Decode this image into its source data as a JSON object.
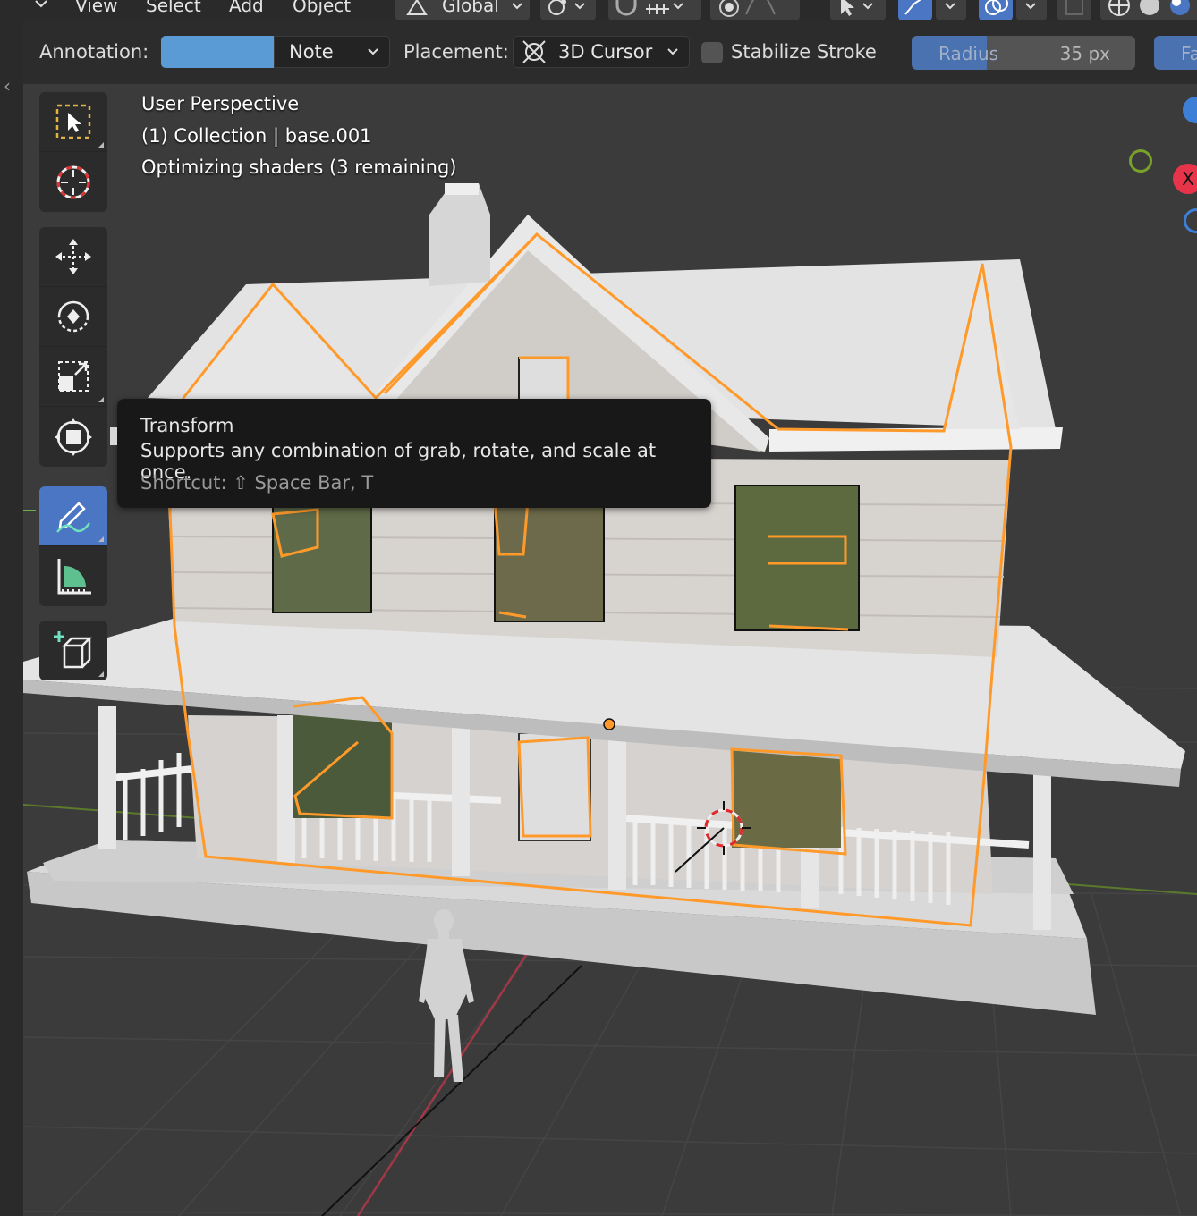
{
  "header": {
    "menu": [
      "View",
      "Select",
      "Add",
      "Object"
    ],
    "orientation_label": "Global"
  },
  "tool_settings": {
    "annotation_label": "Annotation:",
    "annotation_color": "#5b9bd5",
    "layer_value": "Note",
    "placement_label": "Placement:",
    "placement_value": "3D Cursor",
    "stabilize_label": "Stabilize Stroke",
    "stabilize_checked": false,
    "radius_label": "Radius",
    "radius_value": "35 px",
    "next_label": "Fa"
  },
  "viewport": {
    "perspective": "User Perspective",
    "collection": "(1) Collection | base.001",
    "status": "Optimizing shaders (3 remaining)"
  },
  "tools": [
    {
      "name": "select-box",
      "active": false
    },
    {
      "name": "cursor",
      "active": false
    },
    {
      "name": "move",
      "active": false
    },
    {
      "name": "rotate",
      "active": false
    },
    {
      "name": "scale",
      "active": false
    },
    {
      "name": "transform",
      "active": false
    },
    {
      "name": "annotate",
      "active": true
    },
    {
      "name": "measure",
      "active": false
    },
    {
      "name": "add-cube",
      "active": false
    }
  ],
  "tooltip": {
    "title": "Transform",
    "description": "Supports any combination of grab, rotate, and scale at once.",
    "shortcut": "Shortcut: ⇧ Space Bar, T"
  },
  "gizmo": {
    "x_label": "X",
    "colors": {
      "x": "#e8344b",
      "y": "#7aa12a",
      "z": "#3d7fd6"
    }
  },
  "colors": {
    "accent": "#4a76c3",
    "annotation_stroke": "#ff9a2a",
    "viewport_bg": "#3b3b3b"
  }
}
